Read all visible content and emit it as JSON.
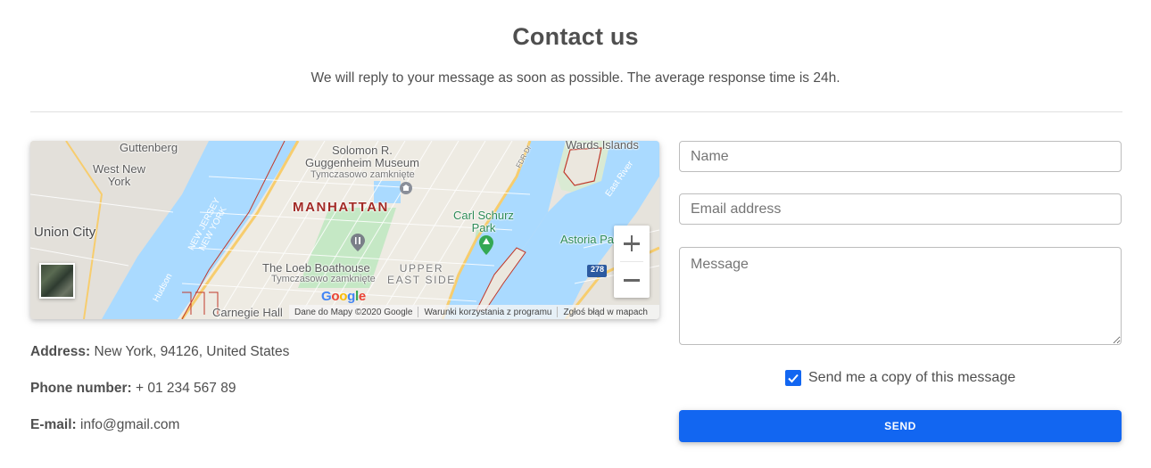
{
  "page": {
    "title": "Contact us",
    "subtitle": "We will reply to your message as soon as possible. The average response time is 24h."
  },
  "map": {
    "labels": {
      "guttenberg": "Guttenberg",
      "west_new_york": "West New\nYork",
      "union_city": "Union City",
      "solomon": "Solomon R.\nGuggenheim Museum",
      "tymczasowo1": "Tymczasowo zamknięte",
      "manhattan": "MANHATTAN",
      "carl_schurz": "Carl Schurz\nPark",
      "wards_islands": "Wards Islands",
      "astoria_park": "Astoria Park",
      "loeb": "The Loeb Boathouse",
      "tymczasowo2": "Tymczasowo zamknięte",
      "upper_east_side": "UPPER\nEAST SIDE",
      "carnegie_hall": "Carnegie Hall",
      "east_river": "East River",
      "new_jersey": "NEW JERSEY\nNEW YORK",
      "hudson": "Hudson",
      "fdr": "FDR Dr",
      "route_278": "278"
    },
    "google_logo": [
      "G",
      "o",
      "o",
      "g",
      "l",
      "e"
    ],
    "attribution": {
      "data": "Dane do Mapy ©2020 Google",
      "terms": "Warunki korzystania z programu",
      "report": "Zgłoś błąd w mapach"
    },
    "colors": {
      "water": "#aadaff",
      "land": "#e8e5df",
      "park": "#c5e8c5",
      "highway": "#f7cd6e",
      "border": "#c0392b"
    }
  },
  "contact": {
    "address_label": "Address:",
    "address_value": "New York, 94126, United States",
    "phone_label": "Phone number:",
    "phone_value": "+ 01 234 567 89",
    "email_label": "E-mail:",
    "email_value": "info@gmail.com"
  },
  "form": {
    "name_placeholder": "Name",
    "email_placeholder": "Email address",
    "message_placeholder": "Message",
    "copy_label": "Send me a copy of this message",
    "copy_checked": true,
    "send_label": "SEND"
  },
  "colors": {
    "primary": "#1266f1",
    "text": "#4f4f4f",
    "divider": "#e0e0e0"
  }
}
